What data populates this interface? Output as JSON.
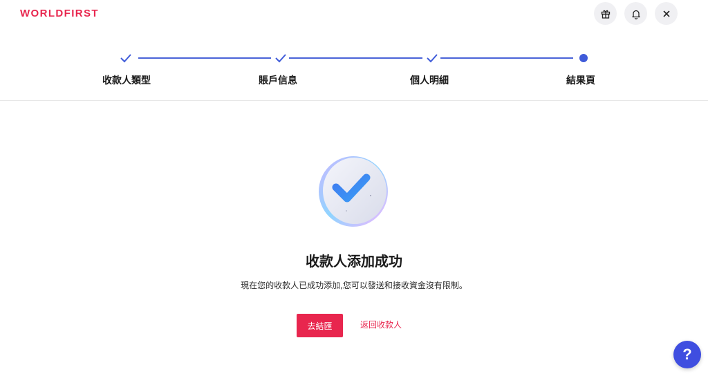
{
  "brand": {
    "logo_text": "WORLDFIRST",
    "color": "#e8264e"
  },
  "header_actions": [
    {
      "name": "gift-icon"
    },
    {
      "name": "bell-icon"
    },
    {
      "name": "close-icon"
    }
  ],
  "stepper": {
    "active_color": "#3f5bd9",
    "steps": [
      {
        "label": "收款人類型",
        "status": "completed"
      },
      {
        "label": "賬戶信息",
        "status": "completed"
      },
      {
        "label": "個人明細",
        "status": "completed"
      },
      {
        "label": "結果頁",
        "status": "current"
      }
    ]
  },
  "result": {
    "title": "收款人添加成功",
    "description": "現在您的收款人已成功添加,您可以發送和接收資金沒有限制。",
    "primary_button": "去結匯",
    "secondary_link": "返回收款人"
  },
  "help": {
    "label": "?"
  }
}
